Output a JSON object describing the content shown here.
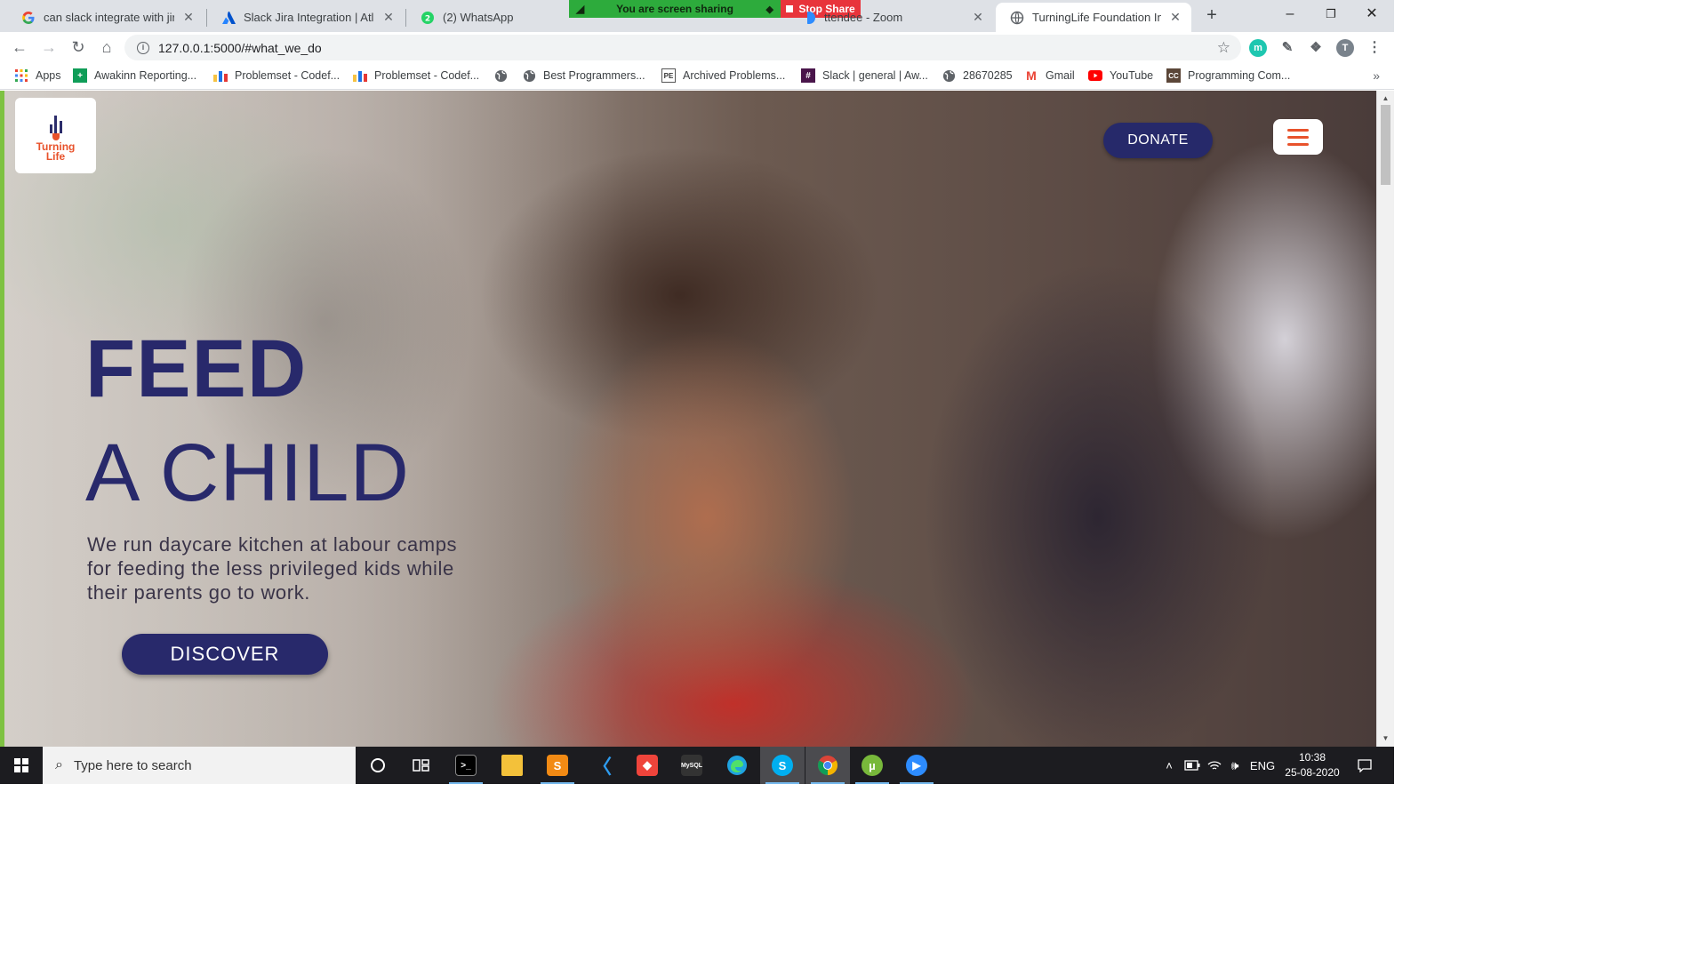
{
  "browser": {
    "tabs": [
      {
        "title": "can slack integrate with jira -",
        "favicon": "google-icon",
        "active": false
      },
      {
        "title": "Slack Jira Integration | Atlassi",
        "favicon": "atlassian-icon",
        "active": false
      },
      {
        "title": "(2) WhatsApp",
        "favicon": "whatsapp-icon",
        "active": false
      },
      {
        "title": "ttendee - Zoom",
        "favicon": "zoom-icon",
        "active": false
      },
      {
        "title": "TurningLife Foundation India",
        "favicon": "globe-icon",
        "active": true
      }
    ],
    "screen_share": {
      "status": "You are screen sharing",
      "stop_label": "Stop Share"
    },
    "url": "127.0.0.1:5000/#what_we_do",
    "profile_initial": "T",
    "extension_initial": "m",
    "bookmarks": [
      {
        "label": "Apps",
        "icon": "apps-grid-icon"
      },
      {
        "label": "Awakinn Reporting...",
        "icon": "sheets-icon"
      },
      {
        "label": "Problemset - Codef...",
        "icon": "codeforces-icon"
      },
      {
        "label": "Problemset - Codef...",
        "icon": "codeforces-icon"
      },
      {
        "label": "",
        "icon": "globe-icon"
      },
      {
        "label": "Best Programmers...",
        "icon": "globe-icon"
      },
      {
        "label": "Archived Problems...",
        "icon": "projecteuler-icon"
      },
      {
        "label": "Slack | general | Aw...",
        "icon": "slack-icon"
      },
      {
        "label": "28670285",
        "icon": "globe-icon"
      },
      {
        "label": "Gmail",
        "icon": "gmail-icon"
      },
      {
        "label": "YouTube",
        "icon": "youtube-icon"
      },
      {
        "label": "Programming Com...",
        "icon": "codechef-icon"
      }
    ]
  },
  "site": {
    "logo": {
      "line1": "Turning",
      "line2": "Life"
    },
    "donate_label": "DONATE",
    "headline_line1": "FEED",
    "headline_line2": "A CHILD",
    "tagline": "We run daycare kitchen at labour camps for feeding the less privileged kids while their parents go to work.",
    "discover_label": "DISCOVER",
    "colors": {
      "brand_navy": "#28296b",
      "brand_orange": "#e8522b"
    }
  },
  "taskbar": {
    "search_placeholder": "Type here to search",
    "language": "ENG",
    "time": "10:38",
    "date": "25-08-2020"
  }
}
